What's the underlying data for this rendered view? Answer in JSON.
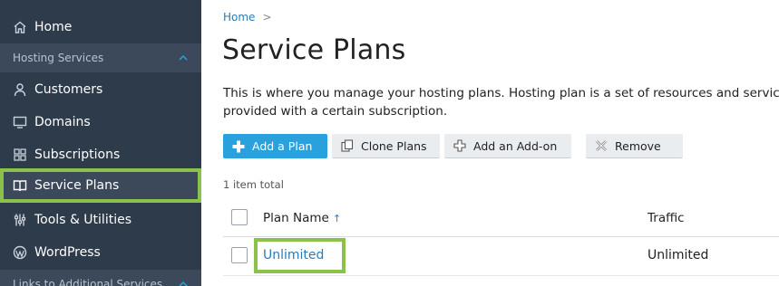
{
  "sidebar": {
    "home": "Home",
    "section_hosting": "Hosting Services",
    "items": [
      {
        "label": "Customers"
      },
      {
        "label": "Domains"
      },
      {
        "label": "Subscriptions"
      },
      {
        "label": "Service Plans"
      },
      {
        "label": "Tools & Utilities"
      },
      {
        "label": "WordPress"
      }
    ],
    "section_links": "Links to Additional Services"
  },
  "breadcrumb": {
    "home": "Home",
    "sep": ">"
  },
  "page": {
    "title": "Service Plans",
    "description_line1": "This is where you manage your hosting plans. Hosting plan is a set of resources and services p",
    "description_line2": "provided with a certain subscription."
  },
  "toolbar": {
    "add_plan": "Add a Plan",
    "clone_plans": "Clone Plans",
    "add_addon": "Add an Add-on",
    "remove": "Remove"
  },
  "table": {
    "count": "1 item total",
    "columns": {
      "plan_name": "Plan Name",
      "sort_indicator": "↑",
      "traffic": "Traffic"
    },
    "rows": [
      {
        "plan_name": "Unlimited",
        "traffic": "Unlimited"
      }
    ]
  },
  "colors": {
    "sidebar_bg": "#2e3b4b",
    "accent": "#28a1dd",
    "highlight": "#8bc34a",
    "link": "#2b7bb9"
  }
}
